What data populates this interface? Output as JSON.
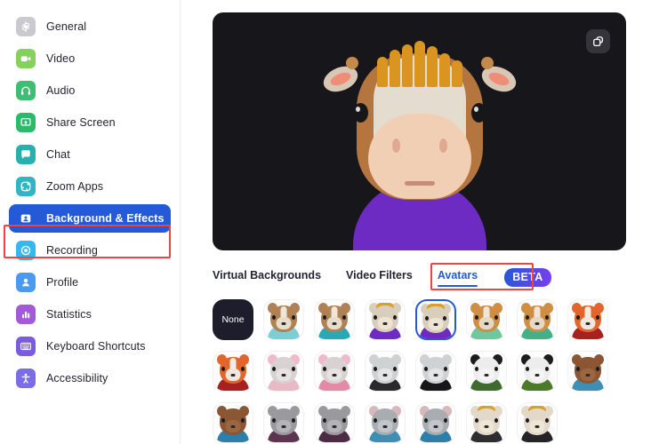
{
  "sidebar": {
    "items": [
      {
        "label": "General",
        "icon": "gear-icon",
        "color": "#c9c9cf",
        "active": false
      },
      {
        "label": "Video",
        "icon": "video-camera-icon",
        "color": "#86d05c",
        "active": false
      },
      {
        "label": "Audio",
        "icon": "headphones-icon",
        "color": "#3fbd72",
        "active": false
      },
      {
        "label": "Share Screen",
        "icon": "share-screen-icon",
        "color": "#2cb96a",
        "active": false
      },
      {
        "label": "Chat",
        "icon": "chat-bubble-icon",
        "color": "#27b0ad",
        "active": false
      },
      {
        "label": "Zoom Apps",
        "icon": "zoom-apps-icon",
        "color": "#31b5c4",
        "active": false
      },
      {
        "label": "Background & Effects",
        "icon": "person-frame-icon",
        "color": "#ffffff",
        "active": true
      },
      {
        "label": "Recording",
        "icon": "record-icon",
        "color": "#35b8ef",
        "active": false
      },
      {
        "label": "Profile",
        "icon": "person-icon",
        "color": "#4a9bf0",
        "active": false
      },
      {
        "label": "Statistics",
        "icon": "bar-chart-icon",
        "color": "#a45ad8",
        "active": false
      },
      {
        "label": "Keyboard Shortcuts",
        "icon": "keyboard-icon",
        "color": "#7b5ce0",
        "active": false
      },
      {
        "label": "Accessibility",
        "icon": "accessibility-icon",
        "color": "#7b6ce8",
        "active": false
      }
    ],
    "active_highlight_color": "#2459d8",
    "annotation_color": "#f4433b"
  },
  "preview": {
    "background_color": "#17171b",
    "corner_button": "duplicate-window-icon",
    "avatar_name": "cow-avatar",
    "avatar_shirt_color": "#6d2bc4",
    "avatar_mane_color": "#d9951f"
  },
  "tabs": {
    "items": [
      {
        "label": "Virtual Backgrounds",
        "active": false
      },
      {
        "label": "Video Filters",
        "active": false
      },
      {
        "label": "Avatars",
        "active": true
      }
    ],
    "badge": "BETA",
    "active_color": "#2459d8",
    "annotation_color": "#f4433b"
  },
  "avatar_grid": {
    "none_label": "None",
    "selected_index": 4,
    "tiles": [
      {
        "name": "none",
        "head": "#000000",
        "face": "#000000",
        "ear": "#000000",
        "shirt": "#000000",
        "strip": "none"
      },
      {
        "name": "dog-teal",
        "head": "#b08154",
        "face": "#e8dccd",
        "ear": "#b08154",
        "shirt": "#79cfd4",
        "strip": "#efe6d9"
      },
      {
        "name": "dog-teal-2",
        "head": "#b08154",
        "face": "#e8dccd",
        "ear": "#b08154",
        "shirt": "#29a9b5",
        "strip": "#efe6d9"
      },
      {
        "name": "cow-purple",
        "head": "#d9cdbb",
        "face": "#efe3d2",
        "ear": "#d9cdbb",
        "shirt": "#6d2bc4",
        "strip": "none"
      },
      {
        "name": "cow-purple-2",
        "head": "#d9cdbb",
        "face": "#efe3d2",
        "ear": "#d9cdbb",
        "shirt": "#6d2bc4",
        "strip": "none"
      },
      {
        "name": "dog-green",
        "head": "#cf8e43",
        "face": "#e6d9c4",
        "ear": "#cf8e43",
        "shirt": "#6fc79d",
        "strip": "#efe6d9"
      },
      {
        "name": "dog-green-2",
        "head": "#cf8e43",
        "face": "#e6d9c4",
        "ear": "#cf8e43",
        "shirt": "#44b089",
        "strip": "#efe6d9"
      },
      {
        "name": "fox-red",
        "head": "#e2662b",
        "face": "#f0e6de",
        "ear": "#e2662b",
        "shirt": "#a8201f",
        "strip": "#f3ece4"
      },
      {
        "name": "fox-red-2",
        "head": "#e2662b",
        "face": "#f0e6de",
        "ear": "#e2662b",
        "shirt": "#a8201f",
        "strip": "#f3ece4"
      },
      {
        "name": "rabbit-pink",
        "head": "#d8d3d2",
        "face": "#e8e3e2",
        "ear": "#f0b9cc",
        "shirt": "#e9b9c6",
        "strip": "none"
      },
      {
        "name": "rabbit-pink-2",
        "head": "#d8d3d2",
        "face": "#e8e3e2",
        "ear": "#f0b9cc",
        "shirt": "#e28aa6",
        "strip": "none"
      },
      {
        "name": "polar-bear",
        "head": "#cfd2d3",
        "face": "#e3e5e6",
        "ear": "#cfd2d3",
        "shirt": "#2a2a2c",
        "strip": "none"
      },
      {
        "name": "polar-bear-2",
        "head": "#cfd2d3",
        "face": "#e3e5e6",
        "ear": "#cfd2d3",
        "shirt": "#17171a",
        "strip": "none"
      },
      {
        "name": "panda-green",
        "head": "#ededed",
        "face": "#f4f4f4",
        "ear": "#1d1d1f",
        "shirt": "#3f6b2e",
        "strip": "none"
      },
      {
        "name": "panda-green-2",
        "head": "#ededed",
        "face": "#f4f4f4",
        "ear": "#1d1d1f",
        "shirt": "#4c7a28",
        "strip": "none"
      },
      {
        "name": "bear-blue",
        "head": "#8a5633",
        "face": "#9c6740",
        "ear": "#8a5633",
        "shirt": "#3f8fb5",
        "strip": "none"
      },
      {
        "name": "bear-blue-2",
        "head": "#8a5633",
        "face": "#9c6740",
        "ear": "#8a5633",
        "shirt": "#2b7fa8",
        "strip": "none"
      },
      {
        "name": "raccoon-plum",
        "head": "#9a9a9e",
        "face": "#b4b4b8",
        "ear": "#9a9a9e",
        "shirt": "#5d3550",
        "strip": "none"
      },
      {
        "name": "raccoon-plum-2",
        "head": "#9a9a9e",
        "face": "#b4b4b8",
        "ear": "#9a9a9e",
        "shirt": "#4d2b45",
        "strip": "none"
      },
      {
        "name": "cat-blue",
        "head": "#a9adb2",
        "face": "#c2c6ca",
        "ear": "#d8b8bd",
        "shirt": "#3f8fb5",
        "strip": "none"
      },
      {
        "name": "cat-blue-2",
        "head": "#a9adb2",
        "face": "#c2c6ca",
        "ear": "#d8b8bd",
        "shirt": "#2b7fa8",
        "strip": "none"
      },
      {
        "name": "cow-dark",
        "head": "#e3d9ca",
        "face": "#efe6d6",
        "ear": "#e3d9ca",
        "shirt": "#2e2e30",
        "strip": "none"
      },
      {
        "name": "cow-dark-2",
        "head": "#e3d9ca",
        "face": "#efe6d6",
        "ear": "#e3d9ca",
        "shirt": "#242426",
        "strip": "none"
      }
    ]
  }
}
